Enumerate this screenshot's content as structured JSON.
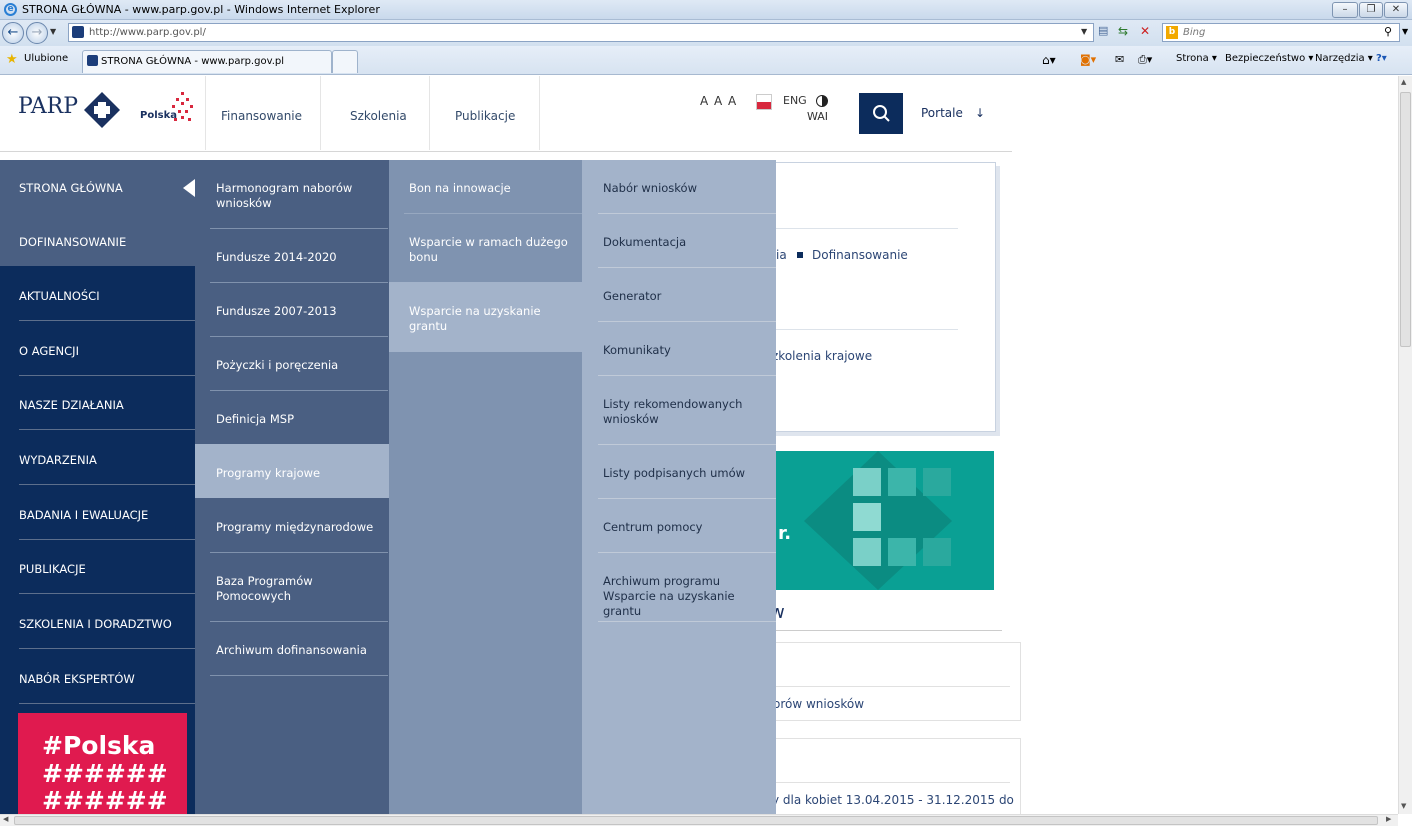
{
  "window": {
    "title": "STRONA GŁÓWNA - www.parp.gov.pl - Windows Internet Explorer"
  },
  "browser": {
    "address": "http://www.parp.gov.pl/",
    "search_placeholder": "Bing",
    "favorites_label": "Ulubione",
    "tab_title": "STRONA GŁÓWNA - www.parp.gov.pl",
    "cmd_strona": "Strona",
    "cmd_bezpieczenstwo": "Bezpieczeństwo",
    "cmd_narzedzia": "Narzędzia"
  },
  "site": {
    "logo": "PARP",
    "polska": "Polska",
    "topnav": [
      "Finansowanie",
      "Szkolenia",
      "Publikacje"
    ],
    "font_sizes": "A A A",
    "eng": "ENG",
    "wai": "WAI",
    "portale": "Portale"
  },
  "menu": {
    "col1": [
      "STRONA GŁÓWNA",
      "DOFINANSOWANIE",
      "AKTUALNOŚCI",
      "O AGENCJI",
      "NASZE DZIAŁANIA",
      "WYDARZENIA",
      "BADANIA I EWALUACJE",
      "PUBLIKACJE",
      "SZKOLENIA I DORADZTWO",
      "NABÓR EKSPERTÓW"
    ],
    "col2": [
      "Harmonogram naborów wniosków",
      "Fundusze 2014-2020",
      "Fundusze 2007-2013",
      "Pożyczki i poręczenia",
      "Definicja MSP",
      "Programy krajowe",
      "Programy międzynarodowe",
      "Baza Programów Pomocowych",
      "Archiwum dofinansowania"
    ],
    "col3": [
      "Bon na innowacje",
      "Wsparcie w ramach dużego bonu",
      "Wsparcie na uzyskanie grantu"
    ],
    "col4": [
      "Nabór wniosków",
      "Dokumentacja",
      "Generator",
      "Komunikaty",
      "Listy rekomendowanych wniosków",
      "Listy podpisanych umów",
      "Centrum pomocy",
      "Archiwum programu Wsparcie na uzyskanie grantu"
    ]
  },
  "banner": {
    "polska_line1": "#Polska",
    "polska_line2": "######",
    "polska_line3": "######"
  },
  "background": {
    "frag1": "ia",
    "frag2": "Dofinansowanie",
    "frag3": "zkolenia krajowe",
    "frag4": "r.",
    "frag5": "w",
    "frag6": "orów wniosków",
    "frag7": "y dla kobiet 13.04.2015 - 31.12.2015 do"
  },
  "colors": {
    "navy": "#0c2c5c",
    "slate": "#4a5f82",
    "steel": "#7f93b0",
    "pale": "#a3b3ca",
    "teal": "#0aa094",
    "pink": "#e01a4f"
  }
}
